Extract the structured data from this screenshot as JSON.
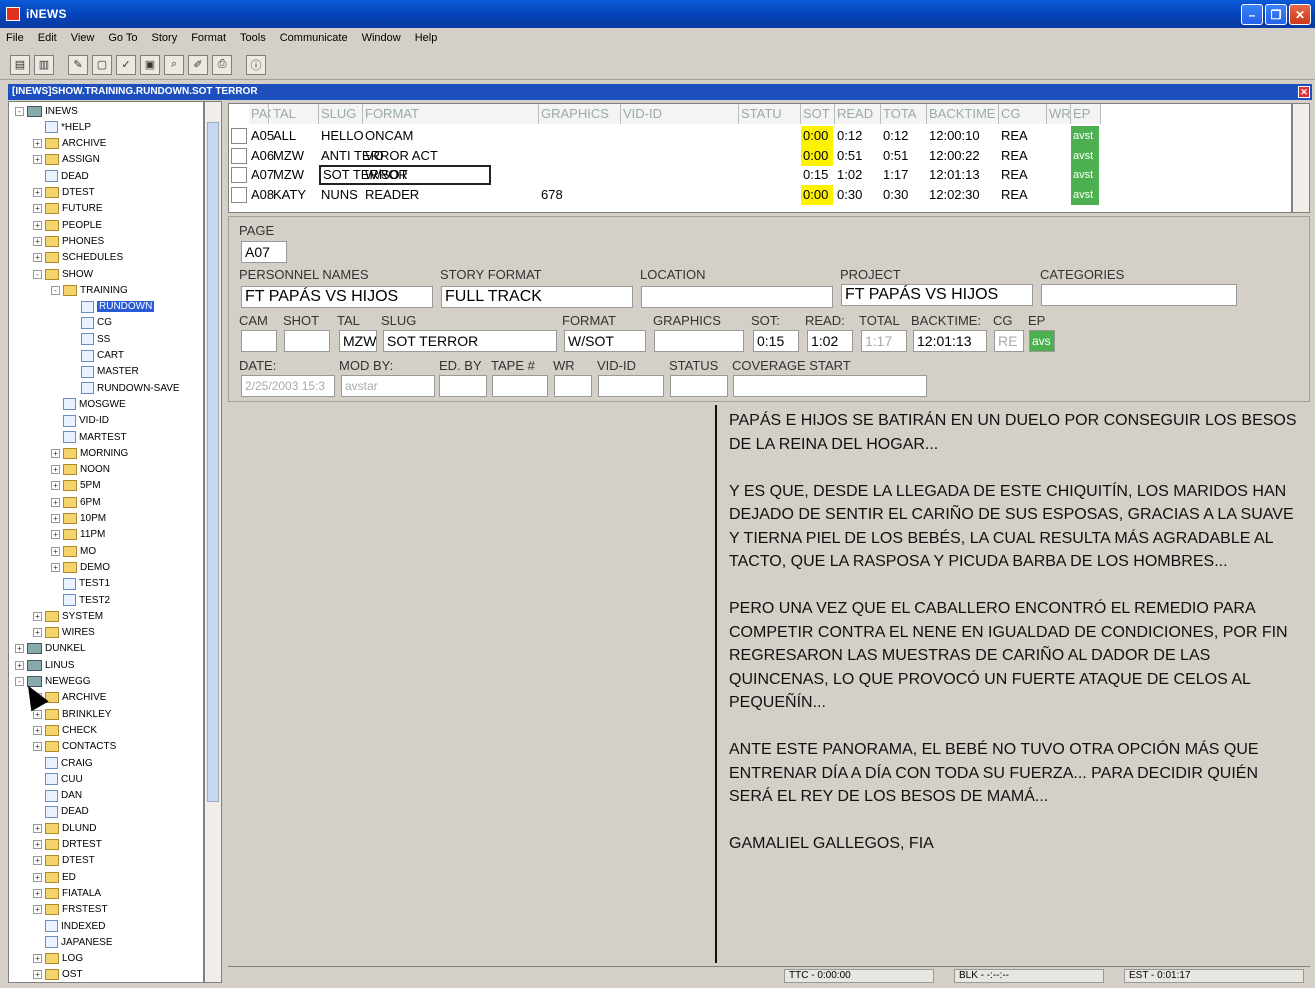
{
  "window": {
    "title": "iNEWS"
  },
  "menu": [
    "File",
    "Edit",
    "View",
    "Go To",
    "Story",
    "Format",
    "Tools",
    "Communicate",
    "Window",
    "Help"
  ],
  "doc_title": "[INEWS]SHOW.TRAINING.RUNDOWN.SOT TERROR",
  "tree": [
    {
      "label": "INEWS",
      "kind": "server",
      "lvl": 0,
      "exp": "-"
    },
    {
      "label": "*HELP",
      "kind": "doc",
      "lvl": 1,
      "exp": ""
    },
    {
      "label": "ARCHIVE",
      "kind": "folder",
      "lvl": 1,
      "exp": "+"
    },
    {
      "label": "ASSIGN",
      "kind": "folder",
      "lvl": 1,
      "exp": "+"
    },
    {
      "label": "DEAD",
      "kind": "doc",
      "lvl": 1,
      "exp": ""
    },
    {
      "label": "DTEST",
      "kind": "folder",
      "lvl": 1,
      "exp": "+"
    },
    {
      "label": "FUTURE",
      "kind": "folder",
      "lvl": 1,
      "exp": "+"
    },
    {
      "label": "PEOPLE",
      "kind": "folder",
      "lvl": 1,
      "exp": "+"
    },
    {
      "label": "PHONES",
      "kind": "folder",
      "lvl": 1,
      "exp": "+"
    },
    {
      "label": "SCHEDULES",
      "kind": "folder",
      "lvl": 1,
      "exp": "+"
    },
    {
      "label": "SHOW",
      "kind": "folder",
      "lvl": 1,
      "exp": "-"
    },
    {
      "label": "TRAINING",
      "kind": "folder",
      "lvl": 2,
      "exp": "-"
    },
    {
      "label": "RUNDOWN",
      "kind": "doc",
      "lvl": 3,
      "exp": "",
      "sel": true
    },
    {
      "label": "CG",
      "kind": "doc",
      "lvl": 3,
      "exp": ""
    },
    {
      "label": "SS",
      "kind": "doc",
      "lvl": 3,
      "exp": ""
    },
    {
      "label": "CART",
      "kind": "doc",
      "lvl": 3,
      "exp": ""
    },
    {
      "label": "MASTER",
      "kind": "doc",
      "lvl": 3,
      "exp": ""
    },
    {
      "label": "RUNDOWN-SAVE",
      "kind": "doc",
      "lvl": 3,
      "exp": ""
    },
    {
      "label": "MOSGWE",
      "kind": "doc",
      "lvl": 2,
      "exp": ""
    },
    {
      "label": "VID-ID",
      "kind": "doc",
      "lvl": 2,
      "exp": ""
    },
    {
      "label": "MARTEST",
      "kind": "doc",
      "lvl": 2,
      "exp": ""
    },
    {
      "label": "MORNING",
      "kind": "folder",
      "lvl": 2,
      "exp": "+"
    },
    {
      "label": "NOON",
      "kind": "folder",
      "lvl": 2,
      "exp": "+"
    },
    {
      "label": "5PM",
      "kind": "folder",
      "lvl": 2,
      "exp": "+"
    },
    {
      "label": "6PM",
      "kind": "folder",
      "lvl": 2,
      "exp": "+"
    },
    {
      "label": "10PM",
      "kind": "folder",
      "lvl": 2,
      "exp": "+"
    },
    {
      "label": "11PM",
      "kind": "folder",
      "lvl": 2,
      "exp": "+"
    },
    {
      "label": "MO",
      "kind": "folder",
      "lvl": 2,
      "exp": "+"
    },
    {
      "label": "DEMO",
      "kind": "folder",
      "lvl": 2,
      "exp": "+"
    },
    {
      "label": "TEST1",
      "kind": "doc",
      "lvl": 2,
      "exp": ""
    },
    {
      "label": "TEST2",
      "kind": "doc",
      "lvl": 2,
      "exp": ""
    },
    {
      "label": "SYSTEM",
      "kind": "folder",
      "lvl": 1,
      "exp": "+"
    },
    {
      "label": "WIRES",
      "kind": "folder",
      "lvl": 1,
      "exp": "+"
    },
    {
      "label": "DUNKEL",
      "kind": "server",
      "lvl": 0,
      "exp": "+"
    },
    {
      "label": "LINUS",
      "kind": "server",
      "lvl": 0,
      "exp": "+"
    },
    {
      "label": "NEWEGG",
      "kind": "server",
      "lvl": 0,
      "exp": "-"
    },
    {
      "label": "ARCHIVE",
      "kind": "folder",
      "lvl": 1,
      "exp": "+"
    },
    {
      "label": "BRINKLEY",
      "kind": "folder",
      "lvl": 1,
      "exp": "+"
    },
    {
      "label": "CHECK",
      "kind": "folder",
      "lvl": 1,
      "exp": "+"
    },
    {
      "label": "CONTACTS",
      "kind": "folder",
      "lvl": 1,
      "exp": "+"
    },
    {
      "label": "CRAIG",
      "kind": "doc",
      "lvl": 1,
      "exp": ""
    },
    {
      "label": "CUU",
      "kind": "doc",
      "lvl": 1,
      "exp": ""
    },
    {
      "label": "DAN",
      "kind": "doc",
      "lvl": 1,
      "exp": ""
    },
    {
      "label": "DEAD",
      "kind": "doc",
      "lvl": 1,
      "exp": ""
    },
    {
      "label": "DLUND",
      "kind": "folder",
      "lvl": 1,
      "exp": "+"
    },
    {
      "label": "DRTEST",
      "kind": "folder",
      "lvl": 1,
      "exp": "+"
    },
    {
      "label": "DTEST",
      "kind": "folder",
      "lvl": 1,
      "exp": "+"
    },
    {
      "label": "ED",
      "kind": "folder",
      "lvl": 1,
      "exp": "+"
    },
    {
      "label": "FIATALA",
      "kind": "folder",
      "lvl": 1,
      "exp": "+"
    },
    {
      "label": "FRSTEST",
      "kind": "folder",
      "lvl": 1,
      "exp": "+"
    },
    {
      "label": "INDEXED",
      "kind": "doc",
      "lvl": 1,
      "exp": ""
    },
    {
      "label": "JAPANESE",
      "kind": "doc",
      "lvl": 1,
      "exp": ""
    },
    {
      "label": "LOG",
      "kind": "folder",
      "lvl": 1,
      "exp": "+"
    },
    {
      "label": "OST",
      "kind": "folder",
      "lvl": 1,
      "exp": "+"
    }
  ],
  "grid": {
    "headers": [
      "PAGE",
      "TAL",
      "SLUG",
      "FORMAT",
      "GRAPHICS",
      "VID-ID",
      "STATU",
      "SOT",
      "READ",
      "TOTA",
      "BACKTIME",
      "CG",
      "WR",
      "EP"
    ],
    "rows": [
      {
        "page": "A05",
        "tal": "ALL",
        "slug": "HELLO",
        "format": "ONCAM",
        "graphics": "",
        "sot": "0:00",
        "read": "0:12",
        "total": "0:12",
        "back": "12:00:10",
        "cg": "REA",
        "ep": "avst"
      },
      {
        "page": "A06",
        "tal": "MZW",
        "slug": "ANTI TERROR ACT",
        "format": "VO",
        "graphics": "",
        "sot": "0:00",
        "read": "0:51",
        "total": "0:51",
        "back": "12:00:22",
        "cg": "REA",
        "ep": "avst"
      },
      {
        "page": "A07",
        "tal": "MZW",
        "slug": "SOT TERROR",
        "format": "W/SOT",
        "graphics": "",
        "sot": "0:15",
        "read": "1:02",
        "total": "1:17",
        "back": "12:01:13",
        "cg": "REA",
        "ep": "avst"
      },
      {
        "page": "A08",
        "tal": "KATY",
        "slug": "NUNS",
        "format": "READER",
        "graphics": "678",
        "sot": "0:00",
        "read": "0:30",
        "total": "0:30",
        "back": "12:02:30",
        "cg": "REA",
        "ep": "avst"
      }
    ]
  },
  "form": {
    "page_label": "PAGE",
    "page": "A07",
    "personnel_label": "PERSONNEL NAMES",
    "personnel": "FT PAPÁS VS HIJOS",
    "story_format_label": "STORY FORMAT",
    "story_format": "FULL TRACK",
    "location_label": "LOCATION",
    "location": "",
    "project_label": "PROJECT",
    "project": "FT PAPÁS VS HIJOS",
    "categories_label": "CATEGORIES",
    "categories": "",
    "cam_label": "CAM",
    "shot_label": "SHOT",
    "tal_label": "TAL",
    "tal": "MZW",
    "slug_label": "SLUG",
    "slug": "SOT TERROR",
    "format_label": "FORMAT",
    "format": "W/SOT",
    "graphics_label": "GRAPHICS",
    "sot_label": "SOT:",
    "sot": "0:15",
    "read_label": "READ:",
    "read": "1:02",
    "total_label": "TOTAL",
    "total": "1:17",
    "backtime_label": "BACKTIME:",
    "backtime": "12:01:13",
    "cg_label": "CG",
    "cg": "RE",
    "ep_label": "EP",
    "ep": "avs",
    "date_label": "DATE:",
    "date": "2/25/2003 15:3",
    "modby_label": "MOD BY:",
    "modby": "avstar",
    "edby_label": "ED. BY",
    "tape_label": "TAPE #",
    "wr_label": "WR",
    "vidid_label": "VID-ID",
    "status_label": "STATUS",
    "coverage_label": "COVERAGE START"
  },
  "script": [
    "PAPÁS E HIJOS SE BATIRÁN EN UN DUELO POR CONSEGUIR LOS BESOS DE LA REINA DEL HOGAR...",
    "Y ES QUE, DESDE LA LLEGADA DE ESTE CHIQUITÍN, LOS MARIDOS HAN DEJADO DE SENTIR EL CARIÑO DE SUS ESPOSAS, GRACIAS A LA SUAVE Y TIERNA PIEL DE LOS BEBÉS, LA CUAL RESULTA MÁS AGRADABLE AL TACTO, QUE LA RASPOSA Y PICUDA BARBA DE LOS HOMBRES...",
    "PERO UNA VEZ QUE EL CABALLERO ENCONTRÓ EL REMEDIO PARA COMPETIR CONTRA EL NENE EN IGUALDAD DE CONDICIONES, POR FIN REGRESARON LAS MUESTRAS DE CARIÑO AL DADOR DE LAS QUINCENAS, LO QUE PROVOCÓ UN FUERTE ATAQUE DE CELOS AL PEQUEÑÍN...",
    "ANTE ESTE PANORAMA, EL BEBÉ NO TUVO OTRA OPCIÓN MÁS QUE ENTRENAR DÍA A DÍA CON TODA SU FUERZA... PARA DECIDIR QUIÉN SERÁ EL REY DE LOS BESOS DE MAMÁ...",
    "GAMALIEL GALLEGOS, FIA"
  ],
  "status": {
    "ttc": "TTC - 0:00:00",
    "blk": "BLK - -:--:--",
    "est": "EST - 0:01:17"
  }
}
